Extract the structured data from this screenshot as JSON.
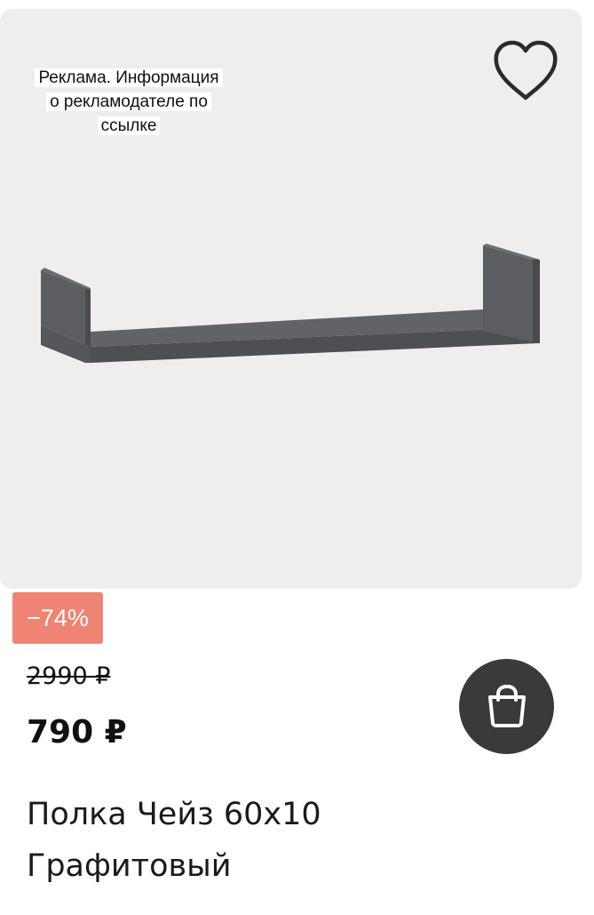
{
  "ad_notice": {
    "line1": "Реклама. Информация",
    "line2": "о рекламодателе по",
    "line3": "ссылке"
  },
  "favorite_icon": "heart-outline-icon",
  "cart_icon": "shopping-bag-icon",
  "product": {
    "discount": "−74%",
    "old_price": "2990 ₽",
    "price": "790 ₽",
    "title_line1": "Полка Чейз 60х10",
    "title_line2": "Графитовый"
  },
  "colors": {
    "image_background": "#efeeed",
    "discount_badge": "#ef8474",
    "cart_button": "#3a3a3a",
    "shelf": "#5a5b5e"
  }
}
